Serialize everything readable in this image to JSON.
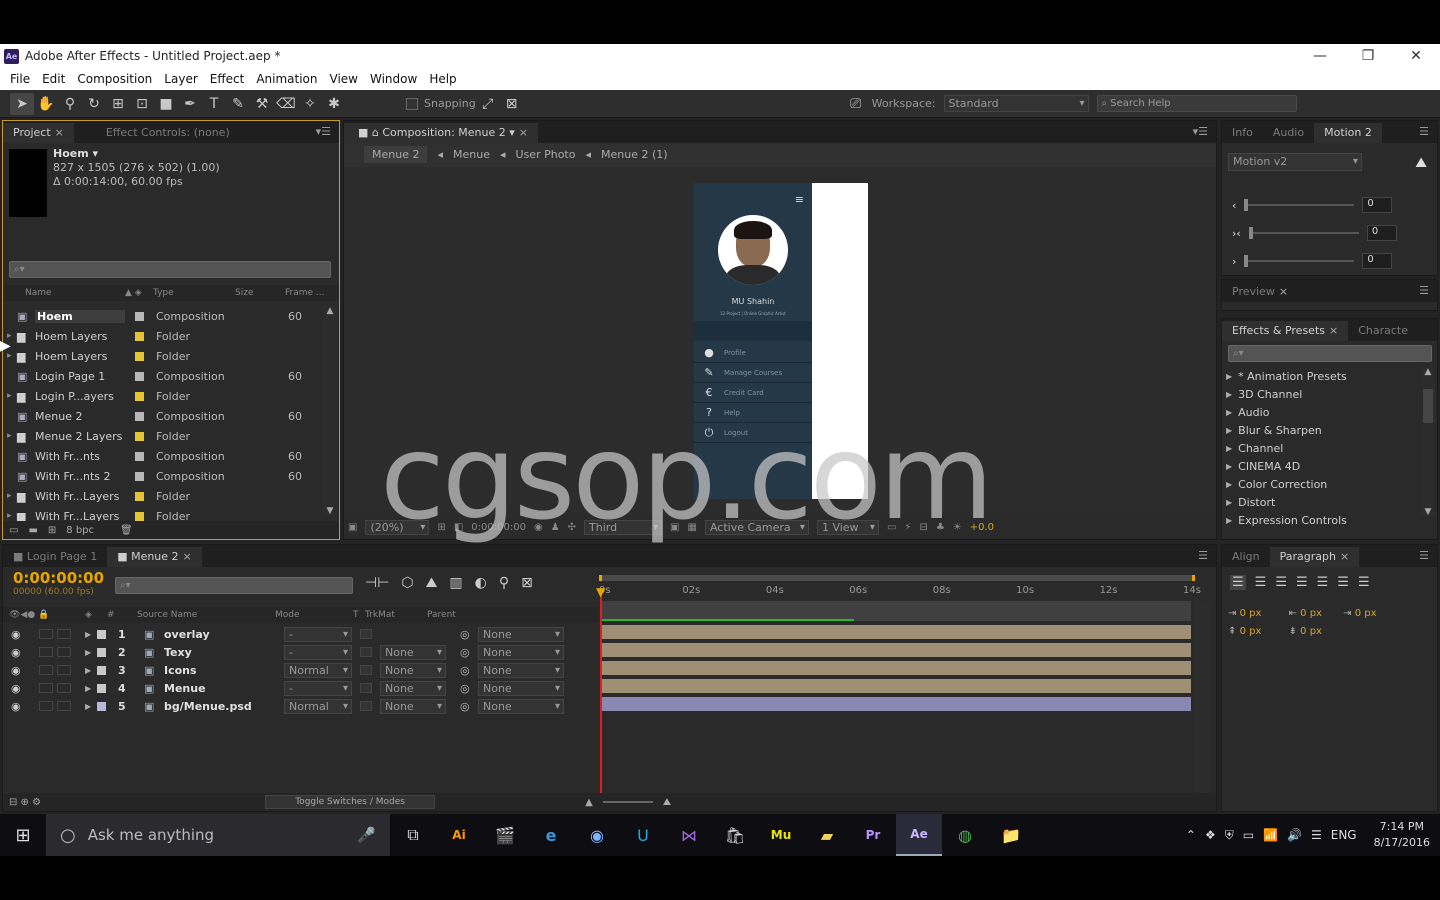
{
  "window": {
    "title": "Adobe After Effects - Untitled Project.aep *",
    "app_icon": "Ae",
    "min": "—",
    "restore": "❐",
    "close": "✕"
  },
  "menu": [
    "File",
    "Edit",
    "Composition",
    "Layer",
    "Effect",
    "Animation",
    "View",
    "Window",
    "Help"
  ],
  "toolbar": {
    "snapping": "Snapping",
    "workspace_label": "Workspace:",
    "workspace_value": "Standard",
    "search_help": "Search Help"
  },
  "project": {
    "tab_project": "Project",
    "tab_effect_controls": "Effect Controls: (none)",
    "item_name": "Hoem ▾",
    "item_info1": "827 x 1505  (276 x 502) (1.00)",
    "item_info2": "Δ 0:00:14:00, 60.00 fps",
    "search_placeholder": "⌕▾",
    "columns": {
      "name": "Name",
      "type": "Type",
      "size": "Size",
      "frame": "Frame ..."
    },
    "items": [
      {
        "name": "Hoem",
        "type": "Composition",
        "frame": "60",
        "kind": "comp",
        "selected": true
      },
      {
        "name": "Hoem Layers",
        "type": "Folder",
        "frame": "",
        "kind": "folder"
      },
      {
        "name": "Hoem Layers",
        "type": "Folder",
        "frame": "",
        "kind": "folder"
      },
      {
        "name": "Login Page 1",
        "type": "Composition",
        "frame": "60",
        "kind": "comp"
      },
      {
        "name": "Login P...ayers",
        "type": "Folder",
        "frame": "",
        "kind": "folder"
      },
      {
        "name": "Menue 2",
        "type": "Composition",
        "frame": "60",
        "kind": "comp"
      },
      {
        "name": "Menue 2 Layers",
        "type": "Folder",
        "frame": "",
        "kind": "folder"
      },
      {
        "name": "With Fr...nts",
        "type": "Composition",
        "frame": "60",
        "kind": "comp"
      },
      {
        "name": "With Fr...nts 2",
        "type": "Composition",
        "frame": "60",
        "kind": "comp"
      },
      {
        "name": "With Fr...Layers",
        "type": "Folder",
        "frame": "",
        "kind": "folder"
      },
      {
        "name": "With Fr...Layers",
        "type": "Folder",
        "frame": "",
        "kind": "folder"
      }
    ],
    "bpc": "8 bpc"
  },
  "composition": {
    "tab": "Composition: Menue 2",
    "breadcrumbs": [
      "Menue 2",
      "Menue",
      "User Photo",
      "Menue 2 (1)"
    ],
    "zoom": "(20%)",
    "timecode": "0:00:00:00",
    "resolution": "Third",
    "camera": "Active Camera",
    "view": "1 View",
    "exposure": "+0.0",
    "phone": {
      "user_name": "MU Shahin",
      "user_sub": "12 Project | Online Graphic Artist",
      "menu": [
        "Profile",
        "Manage Courses",
        "Credit Card",
        "Help",
        "Logout"
      ]
    }
  },
  "motion": {
    "tabs": [
      "Info",
      "Audio",
      "Motion 2"
    ],
    "preset": "Motion v2",
    "values": [
      "0",
      "0",
      "0"
    ]
  },
  "preview": {
    "tab": "Preview"
  },
  "effects": {
    "tab": "Effects & Presets",
    "tab2": "Characte",
    "items": [
      "* Animation Presets",
      "3D Channel",
      "Audio",
      "Blur & Sharpen",
      "Channel",
      "CINEMA 4D",
      "Color Correction",
      "Distort",
      "Expression Controls"
    ]
  },
  "timeline": {
    "tabs": [
      "Login Page 1",
      "Menue 2"
    ],
    "time": "0:00:00:00",
    "fps": "00000 (60.00 fps)",
    "columns": {
      "source": "Source Name",
      "mode": "Mode",
      "t": "T",
      "trkmat": "TrkMat",
      "parent": "Parent"
    },
    "ruler": [
      "0s",
      "02s",
      "04s",
      "06s",
      "08s",
      "10s",
      "12s",
      "14s"
    ],
    "layers": [
      {
        "num": "1",
        "name": "overlay",
        "mode": "-",
        "trkmat": "",
        "parent": "None",
        "color": "#c9c9c9"
      },
      {
        "num": "2",
        "name": "Texy",
        "mode": "-",
        "trkmat": "None",
        "parent": "None",
        "color": "#c9c9c9"
      },
      {
        "num": "3",
        "name": "Icons",
        "mode": "Normal",
        "trkmat": "None",
        "parent": "None",
        "color": "#c9c9c9"
      },
      {
        "num": "4",
        "name": "Menue",
        "mode": "-",
        "trkmat": "None",
        "parent": "None",
        "color": "#c9c9c9"
      },
      {
        "num": "5",
        "name": "bg/Menue.psd",
        "mode": "Normal",
        "trkmat": "None",
        "parent": "None",
        "color": "#b9b9d9"
      }
    ],
    "toggle": "Toggle Switches / Modes"
  },
  "align": {
    "tab": "Align",
    "tab2": "Paragraph",
    "px": "0 px"
  },
  "taskbar": {
    "search": "Ask me anything",
    "time": "7:14 PM",
    "date": "8/17/2016",
    "lang": "ENG"
  },
  "watermark": "cgsop.com",
  "colors": {
    "accent": "#e8a500",
    "timecode": "#e8a500",
    "layer_bar": "#9e8f75",
    "psd_bar": "#8a89b3"
  }
}
